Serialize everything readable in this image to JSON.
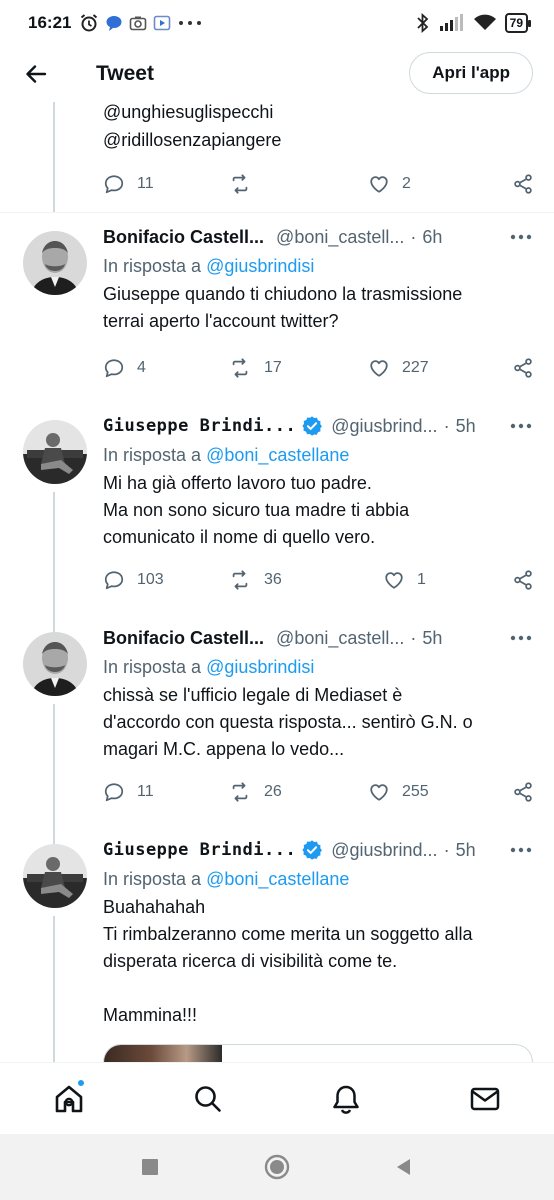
{
  "status_bar": {
    "time": "16:21",
    "battery": "79"
  },
  "header": {
    "title": "Tweet",
    "open_app_label": "Apri l'app"
  },
  "partial_tweet": {
    "lines": [
      "@unghiesuglispecchi",
      "@ridillosenzapiangere"
    ],
    "replies": "11",
    "retweets": "",
    "likes": "2"
  },
  "tweets": [
    {
      "name": "Bonifacio Castell...",
      "handle": "@boni_castell...",
      "time": "6h",
      "verified": false,
      "reply_prefix": "In risposta a",
      "reply_to": "@giusbrindisi",
      "text": "Giuseppe quando ti chiudono la trasmissione\nterrai aperto l'account twitter?",
      "replies": "4",
      "retweets": "17",
      "likes": "227"
    },
    {
      "name": "Giuseppe Brindi...",
      "handle": "@giusbrind...",
      "time": "5h",
      "verified": true,
      "reply_prefix": "In risposta a",
      "reply_to": "@boni_castellane",
      "text": "Mi ha già offerto lavoro tuo padre.\nMa non sono sicuro tua madre ti abbia\ncomunicato il nome di quello vero.",
      "replies": "103",
      "retweets": "36",
      "likes": "1"
    },
    {
      "name": "Bonifacio Castell...",
      "handle": "@boni_castell...",
      "time": "5h",
      "verified": false,
      "reply_prefix": "In risposta a",
      "reply_to": "@giusbrindisi",
      "text": "chissà se l'ufficio legale di Mediaset è\nd'accordo con questa risposta... sentirò G.N. o\nmagari M.C. appena lo vedo...",
      "replies": "11",
      "retweets": "26",
      "likes": "255"
    },
    {
      "name": "Giuseppe Brindi...",
      "handle": "@giusbrind...",
      "time": "5h",
      "verified": true,
      "reply_prefix": "In risposta a",
      "reply_to": "@boni_castellane",
      "text": "Buahahahah\nTi rimbalzeranno come merita un soggetto alla\ndisperata ricerca di visibilità come te.\n\nMammina!!!"
    }
  ],
  "colors": {
    "accent": "#1d9bf0",
    "muted": "#536471",
    "text": "#0f1419",
    "divider": "#eff3f4"
  },
  "bottom_nav": [
    "home-icon",
    "search-icon",
    "bell-icon",
    "mail-icon"
  ]
}
